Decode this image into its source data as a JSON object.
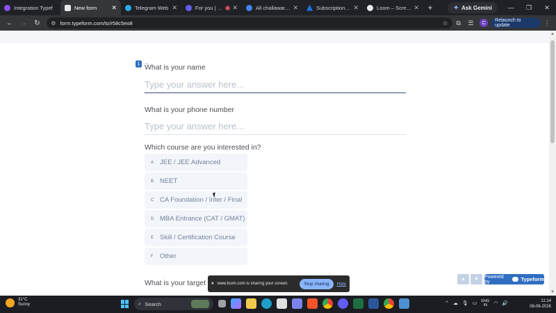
{
  "browser": {
    "tabs": [
      {
        "label": "Integration Typef",
        "favicon_color": "#8c52ff",
        "active": false
      },
      {
        "label": "New form",
        "favicon_color": "#e8eaed",
        "active": true
      },
      {
        "label": "Telegram Web",
        "favicon_color": "#2aabee",
        "active": false
      },
      {
        "label": "For you | Loom",
        "favicon_color": "#625df5",
        "active": false
      },
      {
        "label": "All challawar22 |",
        "favicon_color": "#4285f4",
        "active": false
      },
      {
        "label": "Subscription deta",
        "favicon_color": "#1a73e8",
        "active": false
      },
      {
        "label": "Loom – Screen Re",
        "favicon_color": "#e8eaed",
        "active": false
      }
    ],
    "new_tab_symbol": "+",
    "gemini_label": "Ask Gemini",
    "url": "form.typeform.com/to/r58c5eo8",
    "relaunch_label": "Relaunch to update",
    "profile_initial": "C"
  },
  "form": {
    "question_number": "1",
    "questions": [
      {
        "label": "What is your name",
        "placeholder": "Type your answer here..."
      },
      {
        "label": "What is your phone number",
        "placeholder": "Type your answer here..."
      },
      {
        "label": "Which course are you interested in?"
      },
      {
        "label": "What is your target"
      }
    ],
    "choices": [
      {
        "key": "A",
        "label": "JEE / JEE Advanced"
      },
      {
        "key": "B",
        "label": "NEET"
      },
      {
        "key": "C",
        "label": "CA Foundation / Inter / Final"
      },
      {
        "key": "D",
        "label": "MBA Entrance (CAT / GMAT)"
      },
      {
        "key": "E",
        "label": "Skill / Certification Course"
      },
      {
        "key": "F",
        "label": "Other"
      }
    ],
    "powered_by": "Powered by",
    "brand": "Typeform",
    "brand_color": "#2f6ec1"
  },
  "share_bar": {
    "message": "www.loom.com is sharing your screen.",
    "stop_label": "Stop sharing",
    "hide_label": "Hide"
  },
  "taskbar": {
    "temperature": "31°C",
    "weather": "Sunny",
    "search_label": "Search",
    "lang_top": "ENG",
    "lang_bottom": "IN",
    "time": "11:14",
    "date": "06-06-2026"
  }
}
